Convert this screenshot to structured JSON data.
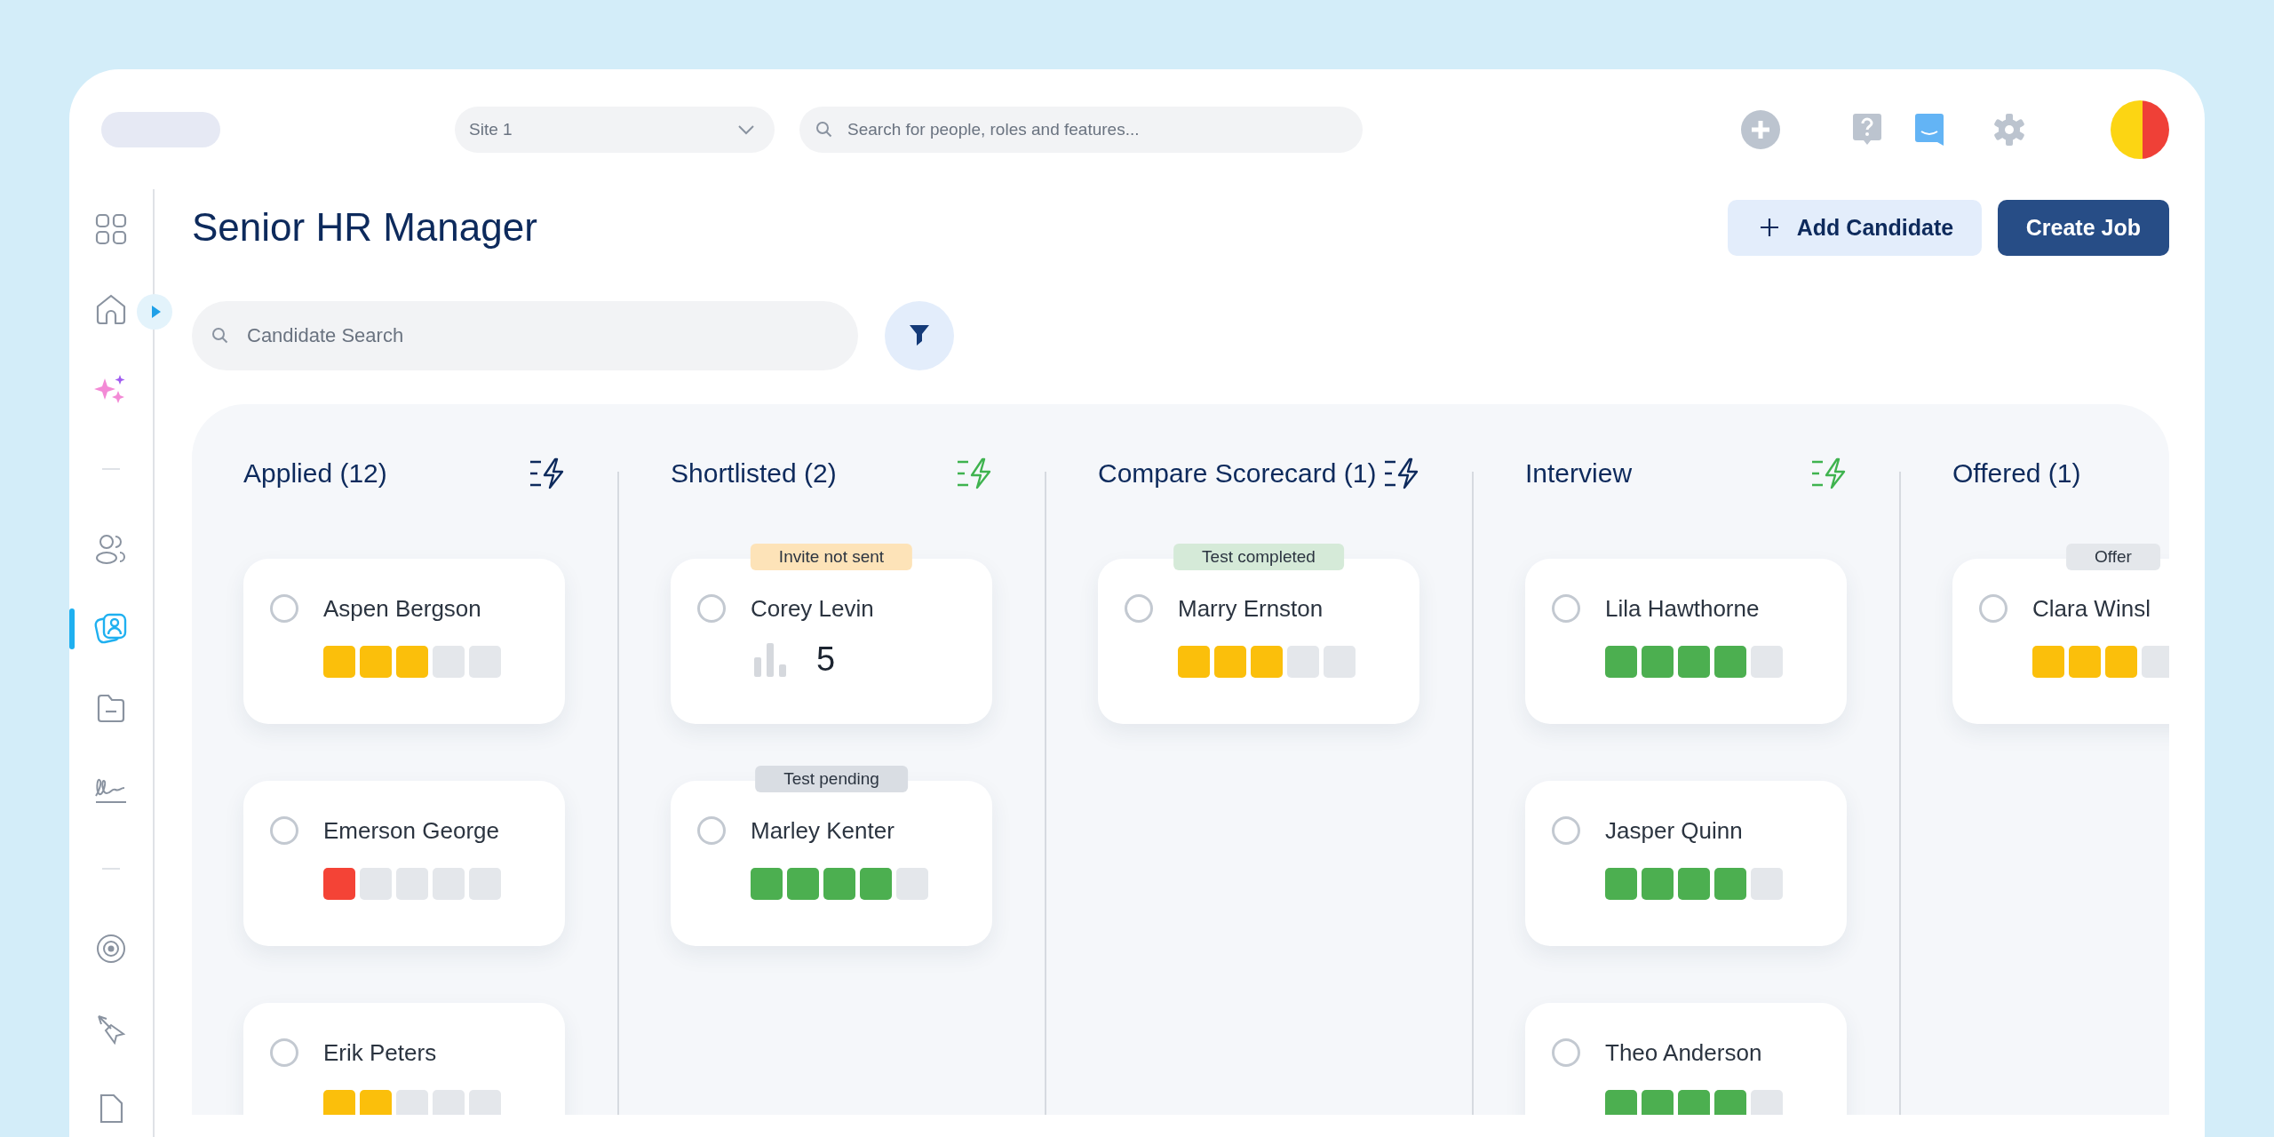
{
  "topbar": {
    "site_select": {
      "value": "Site 1"
    },
    "search": {
      "placeholder": "Search for people, roles and features..."
    }
  },
  "sidebar": {
    "items": [
      {
        "kind": "grid",
        "selected": false
      },
      {
        "kind": "home",
        "selected": false
      },
      {
        "kind": "sparkles",
        "selected": false
      },
      {
        "kind": "divider"
      },
      {
        "kind": "people",
        "selected": false
      },
      {
        "kind": "candidates",
        "selected": true
      },
      {
        "kind": "folder",
        "selected": false
      },
      {
        "kind": "signature",
        "selected": false
      },
      {
        "kind": "divider"
      },
      {
        "kind": "target",
        "selected": false
      },
      {
        "kind": "pointer",
        "selected": false
      },
      {
        "kind": "document",
        "selected": false
      }
    ]
  },
  "page": {
    "title": "Senior HR Manager",
    "buttons": [
      {
        "label": "Add Candidate",
        "kind": "secondary"
      },
      {
        "label": "Create Job",
        "kind": "primary"
      }
    ],
    "candidate_search": {
      "placeholder": "Candidate Search"
    }
  },
  "board": {
    "columns": [
      {
        "title": "Applied (12)",
        "automation_active": false,
        "cards": [
          {
            "name": "Aspen Bergson",
            "selected": false,
            "kind": "rating",
            "stars": 3
          },
          {
            "name": "Emerson George",
            "selected": false,
            "kind": "rating",
            "stars": 1
          },
          {
            "name": "Erik Peters",
            "selected": false,
            "kind": "rating",
            "stars": 2
          }
        ]
      },
      {
        "title": "Shortlisted (2)",
        "automation_active": true,
        "cards": [
          {
            "name": "Corey Levin",
            "selected": false,
            "kind": "score",
            "score": "5",
            "tag": {
              "text": "Invite not sent",
              "color": "#fde3b8"
            }
          },
          {
            "name": "Marley Kenter",
            "selected": false,
            "kind": "rating",
            "stars": 4,
            "tag": {
              "text": "Test pending",
              "color": "#d9dde3"
            }
          }
        ]
      },
      {
        "title": "Compare Scorecard (1)",
        "automation_active": false,
        "cards": [
          {
            "name": "Marry Ernston",
            "selected": false,
            "kind": "rating",
            "stars": 3,
            "tag": {
              "text": "Test completed",
              "color": "#d5ead8"
            }
          }
        ]
      },
      {
        "title": "Interview",
        "automation_active": true,
        "cards": [
          {
            "name": "Lila Hawthorne",
            "selected": false,
            "kind": "rating",
            "stars": 4
          },
          {
            "name": "Jasper Quinn",
            "selected": false,
            "kind": "rating",
            "stars": 4
          },
          {
            "name": "Theo Anderson",
            "selected": false,
            "kind": "rating",
            "stars": 4
          }
        ]
      },
      {
        "title": "Offered (1)",
        "cards": [
          {
            "name": "Clara Winsl",
            "selected": false,
            "kind": "rating",
            "stars": 3,
            "tag": {
              "text": "Offer",
              "color": "#e4e7eb"
            }
          }
        ]
      }
    ]
  }
}
